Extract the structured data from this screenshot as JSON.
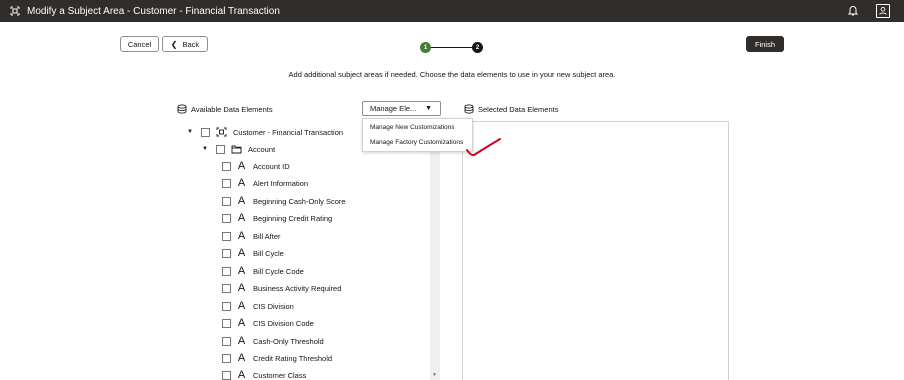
{
  "window": {
    "title": "Modify a Subject Area - Customer - Financial Transaction"
  },
  "toolbar": {
    "cancel_label": "Cancel",
    "back_label": "Back",
    "finish_label": "Finish"
  },
  "steps": [
    "1",
    "2"
  ],
  "instructions": "Add additional subject areas if needed. Choose the data elements to use in your new subject area.",
  "available": {
    "label": "Available Data Elements",
    "dropdown_value": "Manage Ele...",
    "menu_items": [
      "Manage New Customizations",
      "Manage Factory Customizations"
    ],
    "root": "Customer - Financial Transaction",
    "folder": "Account",
    "items": [
      "Account ID",
      "Alert Information",
      "Beginning Cash-Only Score",
      "Beginning Credit Rating",
      "Bill After",
      "Bill Cycle",
      "Bill Cycle Code",
      "Business Activity Required",
      "CIS Division",
      "CIS Division Code",
      "Cash-Only Threshold",
      "Credit Rating Threshold",
      "Customer Class"
    ]
  },
  "selected": {
    "label": "Selected Data Elements"
  },
  "colors": {
    "titlebar": "#312d2a",
    "step_done": "#4c7a34",
    "annotation": "#d0021b"
  }
}
